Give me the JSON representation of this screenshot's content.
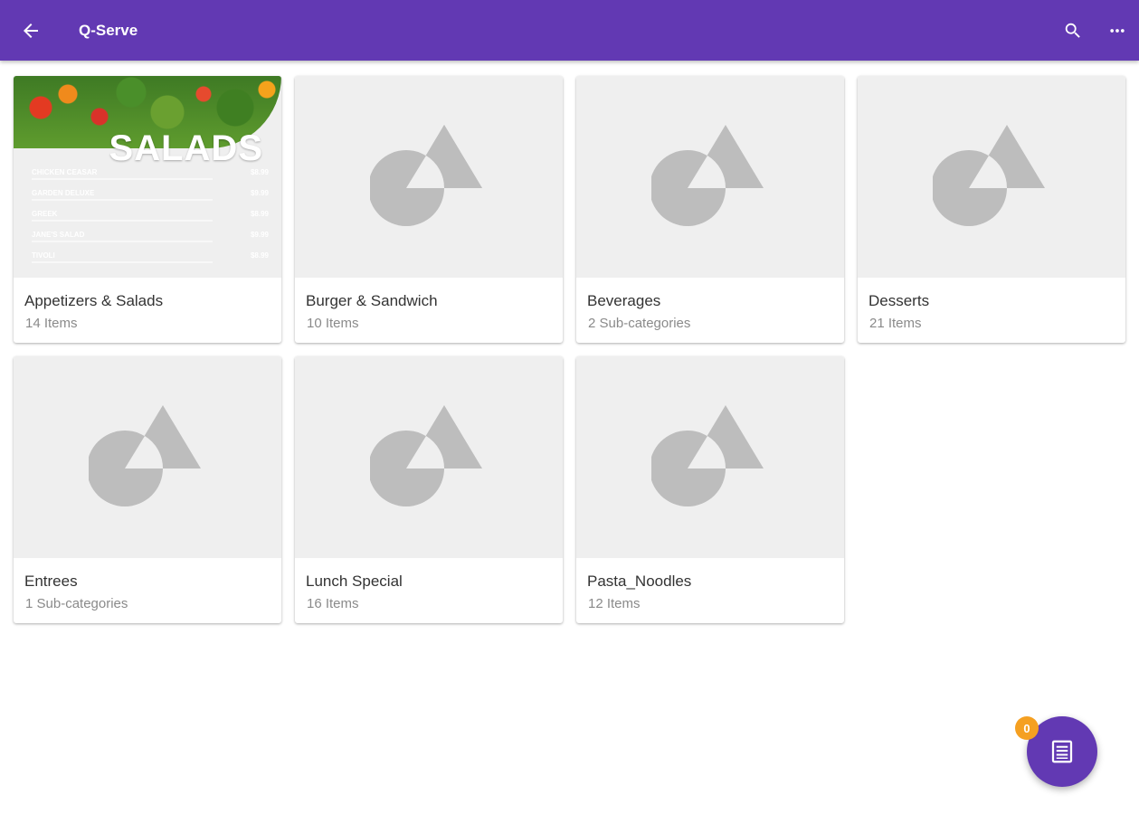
{
  "appbar": {
    "title": "Q-Serve",
    "color": "#6239b3",
    "icons": {
      "back": "arrow-back-icon",
      "search": "search-icon",
      "more": "more-horizontal-icon"
    }
  },
  "categories": [
    {
      "name": "Appetizers & Salads",
      "count": "14 Items",
      "image": "salads-menu"
    },
    {
      "name": "Burger & Sandwich",
      "count": "10 Items",
      "image": "placeholder"
    },
    {
      "name": "Beverages",
      "count": "2 Sub-categories",
      "image": "placeholder"
    },
    {
      "name": "Desserts",
      "count": "21 Items",
      "image": "placeholder"
    },
    {
      "name": "Entrees",
      "count": "1 Sub-categories",
      "image": "placeholder"
    },
    {
      "name": "Lunch Special",
      "count": "16 Items",
      "image": "placeholder"
    },
    {
      "name": "Pasta_Noodles",
      "count": "12 Items",
      "image": "placeholder"
    }
  ],
  "salad_image": {
    "heading": "SALADS",
    "items": [
      {
        "name": "CHICKEN CEASAR",
        "price": "$8.99"
      },
      {
        "name": "GARDEN DELUXE",
        "price": "$9.99"
      },
      {
        "name": "GREEK",
        "price": "$8.99"
      },
      {
        "name": "JANE'S SALAD",
        "price": "$9.99"
      },
      {
        "name": "TIVOLI",
        "price": "$8.99"
      }
    ]
  },
  "cart": {
    "badge_count": "0",
    "icon": "order-list-icon",
    "badge_color": "#f5a021"
  }
}
